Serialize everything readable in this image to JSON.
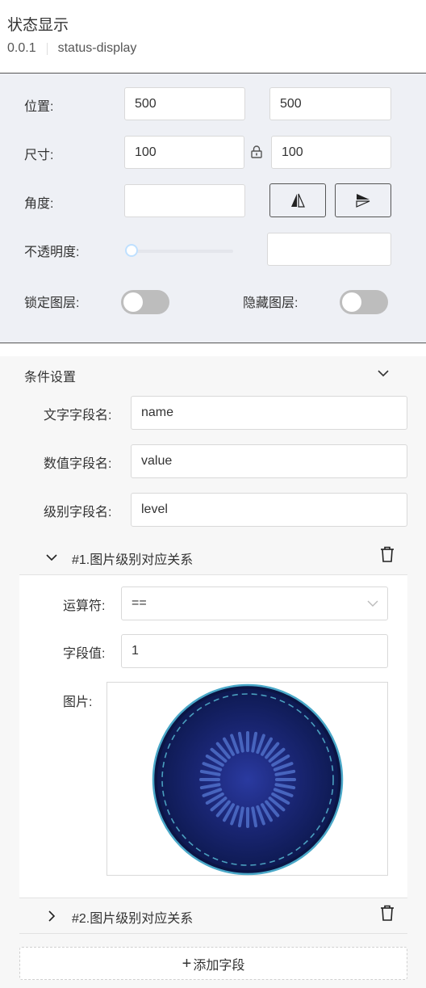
{
  "header": {
    "title": "状态显示",
    "version": "0.0.1",
    "component_id": "status-display"
  },
  "props": {
    "position_label": "位置:",
    "position_x": "500",
    "position_y": "500",
    "size_label": "尺寸:",
    "size_w": "100",
    "size_h": "100",
    "angle_label": "角度:",
    "angle_value": "",
    "opacity_label": "不透明度:",
    "opacity_value": "",
    "opacity_slider_fraction": 0,
    "lock_label": "锁定图层:",
    "lock_on": false,
    "hide_label": "隐藏图层:",
    "hide_on": false
  },
  "condition": {
    "section_title": "条件设置",
    "text_field_label": "文字字段名:",
    "text_field_value": "name",
    "number_field_label": "数值字段名:",
    "number_field_value": "value",
    "level_field_label": "级别字段名:",
    "level_field_value": "level",
    "rules": [
      {
        "title": "#1.图片级别对应关系",
        "expanded": true,
        "operator_label": "运算符:",
        "operator_value": "==",
        "field_value_label": "字段值:",
        "field_value": "1",
        "image_label": "图片:"
      },
      {
        "title": "#2.图片级别对应关系",
        "expanded": false
      }
    ],
    "add_button_label": "添加字段"
  },
  "colors": {
    "panel_bg": "#eef0f5",
    "toggle_off": "#bdbdbd",
    "disc_dark": "#0e1a52",
    "disc_center": "#2a3aa0",
    "disc_ring": "#4aa8c8"
  },
  "icons": {
    "lock": "lock-icon",
    "flip_horizontal": "flip-horizontal-icon",
    "flip_vertical": "flip-vertical-icon",
    "collapse": "chevron-down-icon",
    "expand": "chevron-right-icon",
    "delete": "trash-icon",
    "add": "plus-icon"
  }
}
